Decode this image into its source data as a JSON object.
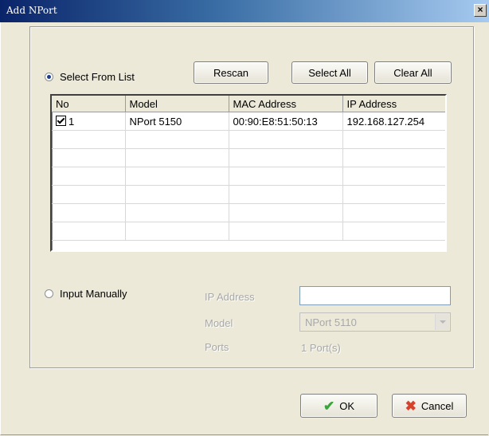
{
  "window": {
    "title": "Add NPort",
    "close_glyph": "×"
  },
  "select_from_list": {
    "label": "Select From List",
    "checked": true
  },
  "toolbar": {
    "rescan_label": "Rescan",
    "select_all_label": "Select All",
    "clear_all_label": "Clear All"
  },
  "device_table": {
    "headers": [
      "No",
      "Model",
      "MAC Address",
      "IP Address"
    ],
    "rows": [
      {
        "no": "1",
        "checked": true,
        "model": "NPort 5150",
        "mac": "00:90:E8:51:50:13",
        "ip": "192.168.127.254"
      }
    ],
    "empty_rows": 6
  },
  "input_manually": {
    "label": "Input Manually",
    "checked": false,
    "ip_label": "IP Address",
    "ip_value": "",
    "model_label": "Model",
    "model_value": "NPort 5110",
    "ports_label": "Ports",
    "ports_value": "1 Port(s)"
  },
  "footer": {
    "ok_label": "OK",
    "cancel_label": "Cancel"
  },
  "icons": {
    "ok": "checkmark-icon",
    "cancel": "x-icon"
  },
  "colors": {
    "title_bar": "#0a246a",
    "radio_selected": "#1b3b8b",
    "ok_icon": "#3aa63a",
    "cancel_icon": "#d8412a"
  }
}
